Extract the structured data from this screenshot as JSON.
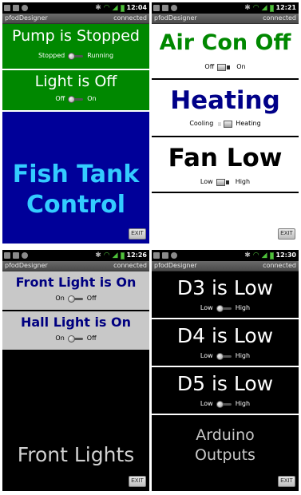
{
  "screens": [
    {
      "status": {
        "time": "12:04"
      },
      "titlebar": {
        "app": "pfodDesigner",
        "connection": "connected"
      },
      "panels": [
        {
          "title": "Pump is Stopped",
          "off_label": "Stopped",
          "on_label": "Running",
          "bg": "#008800",
          "fg": "#ffffff"
        },
        {
          "title": "Light is Off",
          "off_label": "Off",
          "on_label": "On",
          "bg": "#008800",
          "fg": "#ffffff"
        }
      ],
      "footer": {
        "text": "Fish Tank Control",
        "line1": "Fish Tank",
        "line2": "Control",
        "bg": "#000099",
        "fg": "#33ccff"
      },
      "exit_label": "EXIT"
    },
    {
      "status": {
        "time": "12:21"
      },
      "titlebar": {
        "app": "pfodDesigner",
        "connection": "connected"
      },
      "panels": [
        {
          "title": "Air Con Off",
          "off_label": "Off",
          "on_label": "On",
          "bg": "#ffffff",
          "fg": "#008800"
        },
        {
          "title": "Heating",
          "off_label": "Cooling",
          "on_label": "Heating",
          "bg": "#ffffff",
          "fg": "#000088"
        },
        {
          "title": "Fan Low",
          "off_label": "Low",
          "on_label": "High",
          "bg": "#ffffff",
          "fg": "#000000"
        }
      ],
      "exit_label": "EXIT"
    },
    {
      "status": {
        "time": "12:26"
      },
      "titlebar": {
        "app": "pfodDesigner",
        "connection": "connected"
      },
      "panels": [
        {
          "title": "Front Light is On",
          "off_label": "On",
          "on_label": "Off",
          "bg": "#c8c8c8",
          "fg": "#000080"
        },
        {
          "title": "Hall Light is On",
          "off_label": "On",
          "on_label": "Off",
          "bg": "#c8c8c8",
          "fg": "#000080"
        }
      ],
      "footer": {
        "text": "Front Lights",
        "bg": "#000000",
        "fg": "#d0d0d0"
      },
      "exit_label": "EXIT"
    },
    {
      "status": {
        "time": "12:30"
      },
      "titlebar": {
        "app": "pfodDesigner",
        "connection": "connected"
      },
      "panels": [
        {
          "title": "D3 is Low",
          "off_label": "Low",
          "on_label": "High",
          "bg": "#000000",
          "fg": "#ffffff"
        },
        {
          "title": "D4 is Low",
          "off_label": "Low",
          "on_label": "High",
          "bg": "#000000",
          "fg": "#ffffff"
        },
        {
          "title": "D5 is Low",
          "off_label": "Low",
          "on_label": "High",
          "bg": "#000000",
          "fg": "#ffffff"
        }
      ],
      "footer": {
        "text": "Arduino Outputs",
        "line1": "Arduino",
        "line2": "Outputs",
        "bg": "#000000",
        "fg": "#c8c8c8"
      },
      "exit_label": "EXIT"
    }
  ]
}
